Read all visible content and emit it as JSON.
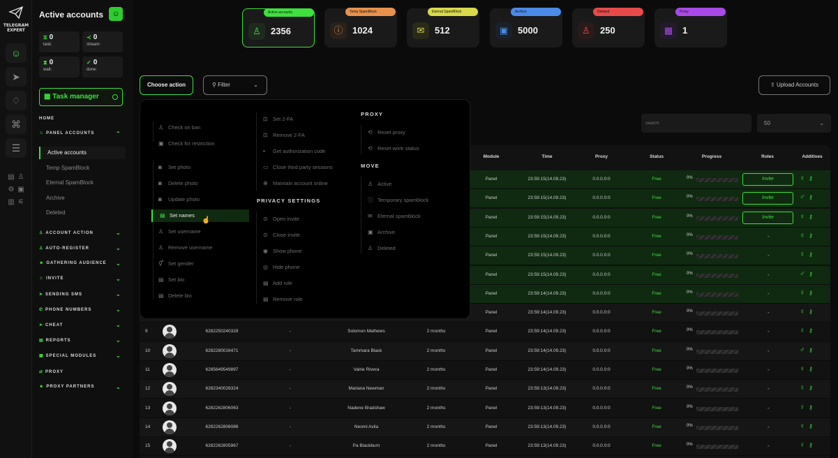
{
  "app": {
    "name": "TELEGRAM EXPERT"
  },
  "sidebar": {
    "title": "Active accounts",
    "stats": [
      {
        "value": "0",
        "label": "task:"
      },
      {
        "value": "0",
        "label": "stream:"
      },
      {
        "value": "0",
        "label": "wait:"
      },
      {
        "value": "0",
        "label": "done:"
      }
    ],
    "task_manager": "Task manager",
    "home": "HOME",
    "panel_accounts": "PANEL ACCOUNTS",
    "subitems": [
      "Active accounts",
      "Temp SpamBlock",
      "Eternal SpamBlock",
      "Archive",
      "Deleted"
    ],
    "sections": [
      "ACCOUNT ACTION",
      "AUTO-REGISTER",
      "GATHERING AUDIENCE",
      "INVITE",
      "SENDING SMS",
      "PHONE NUMBERS",
      "CHEAT",
      "REPORTS",
      "SPECIAL MODULES",
      "PROXY",
      "PROXY PARTNERS"
    ]
  },
  "cards": [
    {
      "label": "Active accounts",
      "value": "2356",
      "color": "#3ee13e"
    },
    {
      "label": "Temp SpamBlock",
      "value": "1024",
      "color": "#e8914a"
    },
    {
      "label": "Eternal SpamBlock",
      "value": "512",
      "color": "#d8d84a"
    },
    {
      "label": "Archive",
      "value": "5000",
      "color": "#4a8be8"
    },
    {
      "label": "Deleted",
      "value": "250",
      "color": "#e84a4a"
    },
    {
      "label": "Proxy",
      "value": "1",
      "color": "#a94ae8"
    }
  ],
  "toolbar": {
    "choose_action": "Choose action",
    "filter": "Filter",
    "upload": "Upload Accounts",
    "search_placeholder": "Search:",
    "per_page": "50"
  },
  "table": {
    "headers": [
      "Module",
      "Time",
      "Proxy",
      "Status",
      "Progress",
      "Roles",
      "Additives"
    ],
    "rows": [
      {
        "num": "",
        "phone": "",
        "dash": "",
        "name": "",
        "age": "",
        "module": "Panel",
        "time": "23:59:15(14.09.23)",
        "proxy": "0.0.0.0:0",
        "status": "Free",
        "progress": "0%",
        "role": "Invite"
      },
      {
        "num": "",
        "phone": "",
        "dash": "",
        "name": "",
        "age": "",
        "module": "Panel",
        "time": "23:59:15(14.09.23)",
        "proxy": "0.0.0.0:0",
        "status": "Free",
        "progress": "0%",
        "role": "Invite"
      },
      {
        "num": "",
        "phone": "",
        "dash": "",
        "name": "",
        "age": "",
        "module": "Panel",
        "time": "23:59:15(14.09.23)",
        "proxy": "0.0.0.0:0",
        "status": "Free",
        "progress": "0%",
        "role": "Invite"
      },
      {
        "num": "",
        "phone": "",
        "dash": "",
        "name": "",
        "age": "",
        "module": "Panel",
        "time": "23:59:15(14.09.23)",
        "proxy": "0.0.0.0:0",
        "status": "Free",
        "progress": "0%",
        "role": "-"
      },
      {
        "num": "",
        "phone": "",
        "dash": "",
        "name": "",
        "age": "",
        "module": "Panel",
        "time": "23:59:15(14.09.23)",
        "proxy": "0.0.0.0:0",
        "status": "Free",
        "progress": "0%",
        "role": "-"
      },
      {
        "num": "",
        "phone": "",
        "dash": "",
        "name": "",
        "age": "",
        "module": "Panel",
        "time": "23:59:15(14.09.23)",
        "proxy": "0.0.0.0:0",
        "status": "Free",
        "progress": "0%",
        "role": "-"
      },
      {
        "num": "",
        "phone": "",
        "dash": "",
        "name": "",
        "age": "",
        "module": "Panel",
        "time": "23:59:14(14.09.23)",
        "proxy": "0.0.0.0:0",
        "status": "Free",
        "progress": "0%",
        "role": "-"
      },
      {
        "num": "",
        "phone": "",
        "dash": "",
        "name": "",
        "age": "",
        "module": "Panel",
        "time": "23:59:14(14.09.23)",
        "proxy": "0.0.0.0:0",
        "status": "Free",
        "progress": "0%",
        "role": "-"
      },
      {
        "num": "9",
        "phone": "6282250240328",
        "dash": "-",
        "name": "Solomon Mathews",
        "age": "2 months",
        "module": "Panel",
        "time": "23:59:14(14.09.23)",
        "proxy": "0.0.0.0:0",
        "status": "Free",
        "progress": "0%",
        "role": "-"
      },
      {
        "num": "10",
        "phone": "6282280016471",
        "dash": "-",
        "name": "Tammara Black",
        "age": "2 months",
        "module": "Panel",
        "time": "23:59:14(14.09.23)",
        "proxy": "0.0.0.0:0",
        "status": "Free",
        "progress": "0%",
        "role": "-"
      },
      {
        "num": "11",
        "phone": "6285649549897",
        "dash": "-",
        "name": "Valrie Rivera",
        "age": "2 months",
        "module": "Panel",
        "time": "23:59:14(14.09.23)",
        "proxy": "0.0.0.0:0",
        "status": "Free",
        "progress": "0%",
        "role": "-"
      },
      {
        "num": "12",
        "phone": "6282340026324",
        "dash": "-",
        "name": "Mariana Newman",
        "age": "2 months",
        "module": "Panel",
        "time": "23:59:13(14.09.23)",
        "proxy": "0.0.0.0:0",
        "status": "Free",
        "progress": "0%",
        "role": "-"
      },
      {
        "num": "13",
        "phone": "6282262806063",
        "dash": "-",
        "name": "Nadene Bradshaw",
        "age": "2 months",
        "module": "Panel",
        "time": "23:59:13(14.09.23)",
        "proxy": "0.0.0.0:0",
        "status": "Free",
        "progress": "0%",
        "role": "-"
      },
      {
        "num": "14",
        "phone": "6282262806086",
        "dash": "-",
        "name": "Neomi Avila",
        "age": "2 months",
        "module": "Panel",
        "time": "23:59:13(14.09.23)",
        "proxy": "0.0.0.0:0",
        "status": "Free",
        "progress": "0%",
        "role": "-"
      },
      {
        "num": "15",
        "phone": "6282262805967",
        "dash": "-",
        "name": "Pa Blackburn",
        "age": "2 months",
        "module": "Panel",
        "time": "23:59:13(14.09.23)",
        "proxy": "0.0.0.0:0",
        "status": "Free",
        "progress": "0%",
        "role": "-"
      }
    ]
  },
  "dropdown": {
    "col1": [
      "Check on ban",
      "Check for restriction",
      "Set photo",
      "Delete photo",
      "Update photo",
      "Set names",
      "Set username",
      "Remove username",
      "Set gender",
      "Set bio",
      "Delete bio"
    ],
    "col2": [
      "Set 2-FA",
      "Remove 2-FA",
      "Get authorization code",
      "Close third party sessions",
      "Maintain account online"
    ],
    "privacy_title": "PRIVACY SETTINGS",
    "col2b": [
      "Open invite",
      "Close invite",
      "Show phone",
      "Hide phone",
      "Add role",
      "Remove role"
    ],
    "proxy_title": "PROXY",
    "proxy": [
      "Reset proxy",
      "Reset work status"
    ],
    "move_title": "MOVE",
    "move": [
      "Active",
      "Temporary spamblock",
      "Eternal spamblock",
      "Archive",
      "Deleted"
    ]
  }
}
